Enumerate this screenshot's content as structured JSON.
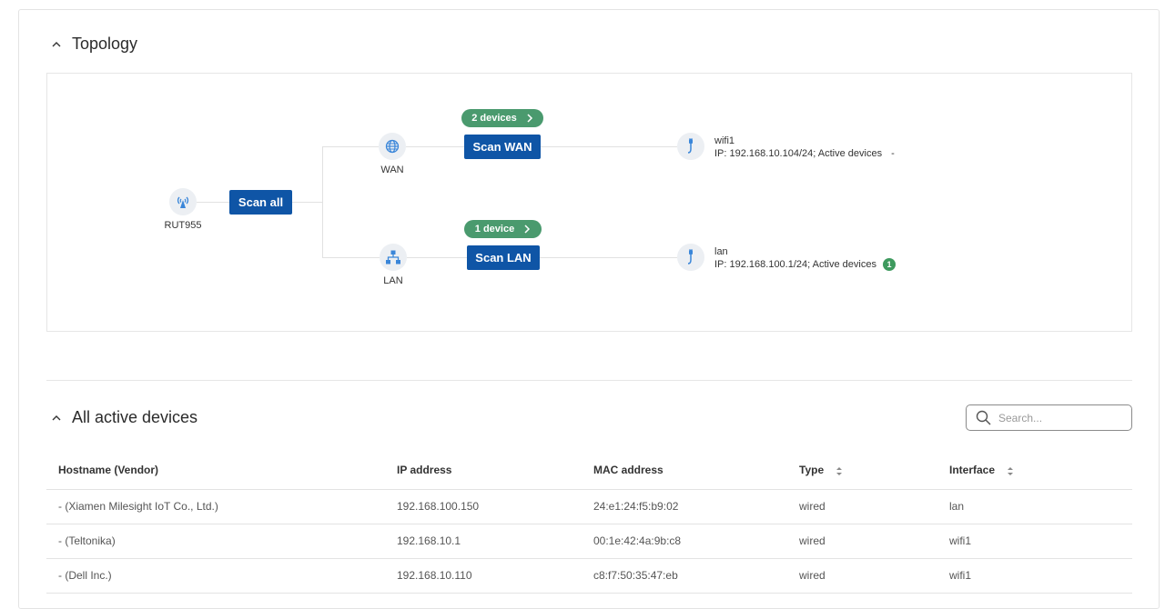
{
  "topology": {
    "title": "Topology",
    "router": {
      "label": "RUT955",
      "scan_label": "Scan all"
    },
    "wan": {
      "label": "WAN",
      "scan_label": "Scan WAN",
      "devices_pill": "2 devices",
      "interface": {
        "name": "wifi1",
        "info": "IP: 192.168.10.104/24; Active devices",
        "active": "-"
      }
    },
    "lan": {
      "label": "LAN",
      "scan_label": "Scan LAN",
      "devices_pill": "1 device",
      "interface": {
        "name": "lan",
        "info": "IP: 192.168.100.1/24; Active devices",
        "active": "1"
      }
    }
  },
  "devices": {
    "title": "All active devices",
    "search_placeholder": "Search...",
    "columns": {
      "hostname": "Hostname (Vendor)",
      "ip": "IP address",
      "mac": "MAC address",
      "type": "Type",
      "interface": "Interface"
    },
    "rows": [
      {
        "hostname": "- (Xiamen Milesight IoT Co., Ltd.)",
        "ip": "192.168.100.150",
        "mac": "24:e1:24:f5:b9:02",
        "type": "wired",
        "interface": "lan"
      },
      {
        "hostname": "- (Teltonika)",
        "ip": "192.168.10.1",
        "mac": "00:1e:42:4a:9b:c8",
        "type": "wired",
        "interface": "wifi1"
      },
      {
        "hostname": "- (Dell Inc.)",
        "ip": "192.168.10.110",
        "mac": "c8:f7:50:35:47:eb",
        "type": "wired",
        "interface": "wifi1"
      }
    ]
  },
  "colors": {
    "primary": "#0f55a6",
    "success": "#4a9a6e",
    "icon": "#3a86d9"
  },
  "icons": [
    "chevron-up-icon",
    "antenna-icon",
    "globe-icon",
    "network-icon",
    "ethernet-icon",
    "chevron-right-icon",
    "search-icon",
    "sort-icon"
  ]
}
